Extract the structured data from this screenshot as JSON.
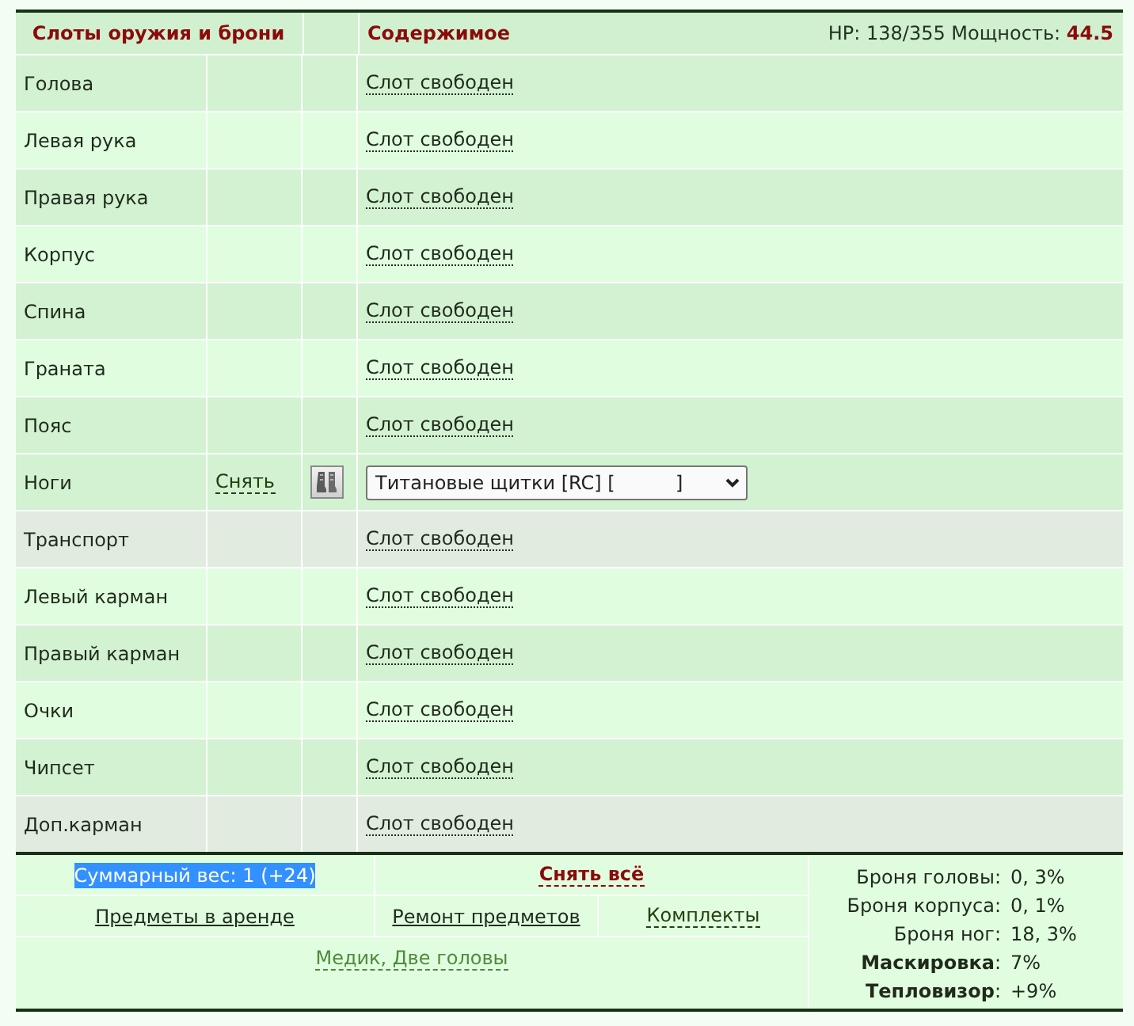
{
  "header": {
    "slots_title": "Слоты оружия и брони",
    "contents_title": "Содержимое",
    "stats": "HP: 138/355 Мощность: **44.5**"
  },
  "slots": [
    {
      "name": "Голова",
      "color": "#d2f2d2",
      "content": {
        "kind": "empty",
        "label": "Слот свободен"
      }
    },
    {
      "name": "Левая рука",
      "color": "#e0fde0",
      "content": {
        "kind": "empty",
        "label": "Слот свободен"
      }
    },
    {
      "name": "Правая рука",
      "color": "#d2f2d2",
      "content": {
        "kind": "empty",
        "label": "Слот свободен"
      }
    },
    {
      "name": "Корпус",
      "color": "#e0fde0",
      "content": {
        "kind": "empty",
        "label": "Слот свободен"
      }
    },
    {
      "name": "Спина",
      "color": "#d2f2d2",
      "content": {
        "kind": "empty",
        "label": "Слот свободен"
      }
    },
    {
      "name": "Граната",
      "color": "#e0fde0",
      "content": {
        "kind": "empty",
        "label": "Слот свободен"
      }
    },
    {
      "name": "Пояс",
      "color": "#d2f2d2",
      "content": {
        "kind": "empty",
        "label": "Слот свободен"
      }
    },
    {
      "name": "Ноги",
      "color": "#d2f2d2",
      "action": "Снять",
      "content": {
        "kind": "item",
        "value": "Титановые щитки [RC] [          ]"
      }
    },
    {
      "name": "Транспорт",
      "color": "#e1ebdf",
      "content": {
        "kind": "empty",
        "label": "Слот свободен"
      }
    },
    {
      "name": "Левый карман",
      "color": "#e0fde0",
      "content": {
        "kind": "empty",
        "label": "Слот свободен"
      }
    },
    {
      "name": "Правый карман",
      "color": "#d2f2d2",
      "content": {
        "kind": "empty",
        "label": "Слот свободен"
      }
    },
    {
      "name": "Очки",
      "color": "#e0fde0",
      "content": {
        "kind": "empty",
        "label": "Слот свободен"
      }
    },
    {
      "name": "Чипсет",
      "color": "#d2f2d2",
      "content": {
        "kind": "empty",
        "label": "Слот свободен"
      }
    },
    {
      "name": "Доп.карман",
      "color": "#e1ebdf",
      "content": {
        "kind": "empty",
        "label": "Слот свободен"
      }
    }
  ],
  "footer": {
    "weight": {
      "text": "Суммарный вес: 1 (+24)",
      "highlighted": true
    },
    "remove_all": "Снять всё",
    "links": [
      {
        "label": "Предметы в аренде",
        "kind": "link"
      },
      {
        "label": "Ремонт предметов",
        "kind": "link"
      },
      {
        "label": "Комплекты",
        "kind": "action"
      }
    ],
    "perks": "Медик, Две головы",
    "stats": [
      {
        "label": "Броня головы:",
        "value": "0, 3%"
      },
      {
        "label": "Броня корпуса:",
        "value": "0, 1%"
      },
      {
        "label": "Броня ног:",
        "value": "18, 3%"
      },
      {
        "label": "**Маскировка**:",
        "value": "7%"
      },
      {
        "label": "**Тепловизор**:",
        "value": "+9%"
      }
    ]
  }
}
